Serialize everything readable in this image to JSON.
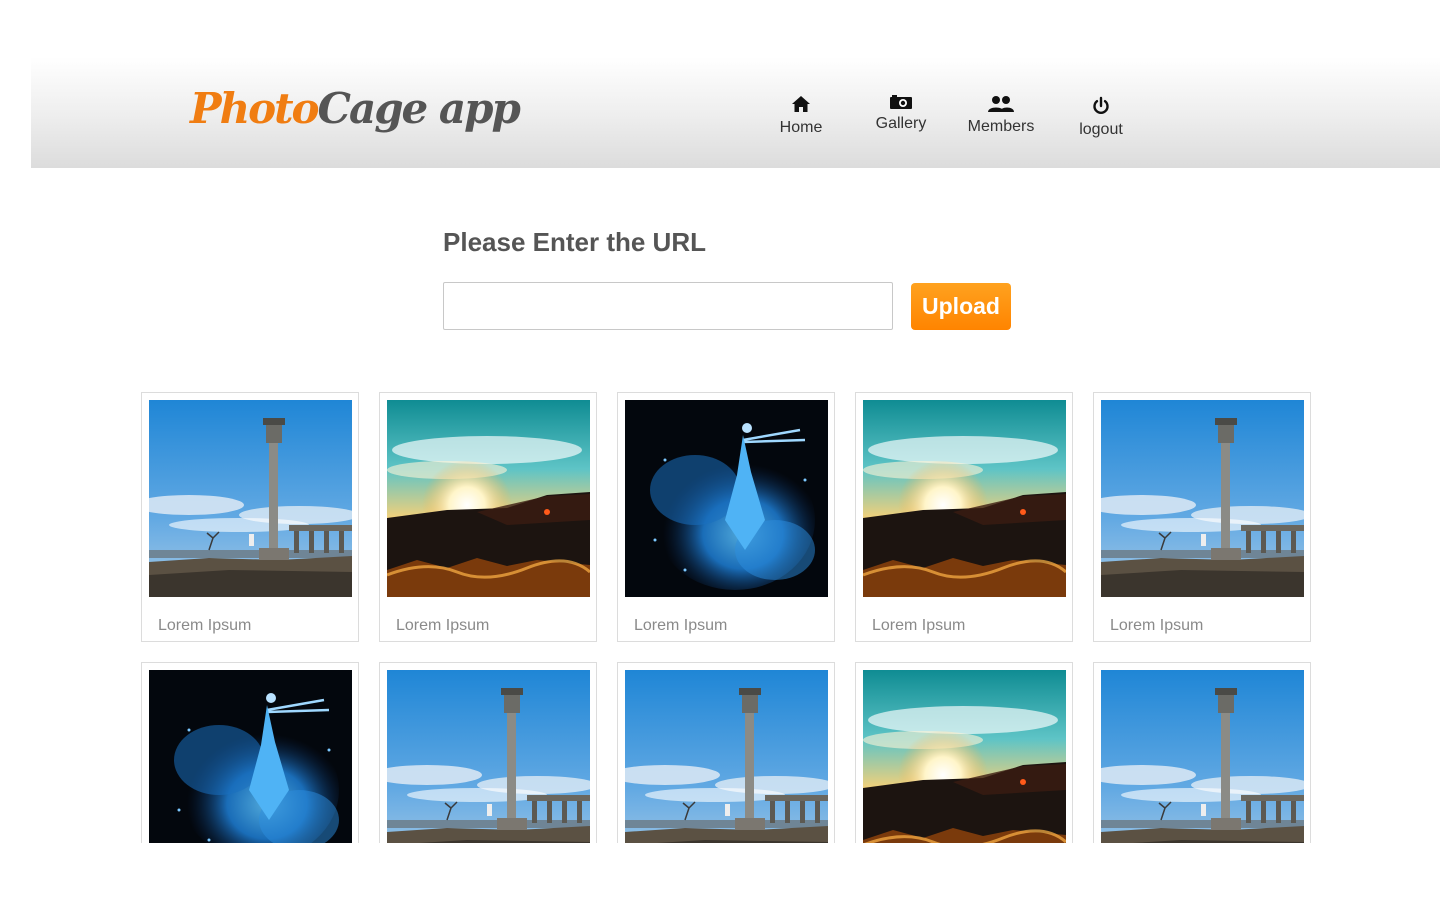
{
  "brand": {
    "part1": "Photo",
    "part2": "Cage",
    "part3": " app"
  },
  "nav": [
    {
      "label": "Home",
      "icon": "home-icon"
    },
    {
      "label": "Gallery",
      "icon": "camera-icon"
    },
    {
      "label": "Members",
      "icon": "users-icon"
    },
    {
      "label": "logout",
      "icon": "power-icon"
    }
  ],
  "upload": {
    "title": "Please Enter the URL",
    "input_value": "",
    "input_placeholder": "",
    "button_label": "Upload"
  },
  "gallery": [
    {
      "image": "tower",
      "caption": "Lorem Ipsum"
    },
    {
      "image": "sunset",
      "caption": "Lorem Ipsum"
    },
    {
      "image": "dancer",
      "caption": "Lorem Ipsum"
    },
    {
      "image": "sunset",
      "caption": "Lorem Ipsum"
    },
    {
      "image": "tower",
      "caption": "Lorem Ipsum"
    },
    {
      "image": "dancer",
      "caption": ""
    },
    {
      "image": "tower",
      "caption": ""
    },
    {
      "image": "tower",
      "caption": ""
    },
    {
      "image": "sunset",
      "caption": ""
    },
    {
      "image": "tower",
      "caption": ""
    }
  ],
  "colors": {
    "accent": "#ff8c00",
    "brand_orange": "#f07d12",
    "text_gray": "#555555"
  }
}
